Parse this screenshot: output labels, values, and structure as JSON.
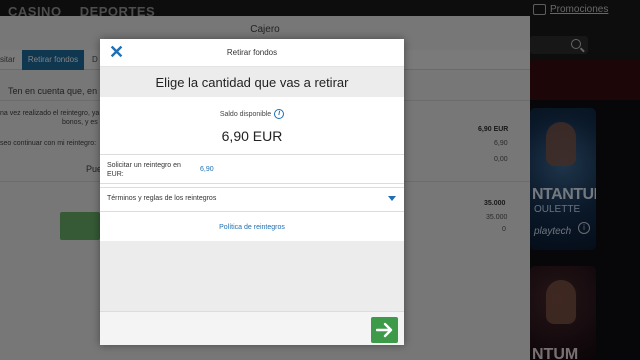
{
  "topbar": {
    "nav": [
      "CASINO",
      "DEPORTES"
    ],
    "promo_label": "Promociones"
  },
  "games": [
    {
      "title": "NTANTUM",
      "subtitle": "OULETTE",
      "brand": "playtech",
      "info": "i"
    },
    {
      "title": "NTUM"
    }
  ],
  "cashier": {
    "title": "Cajero",
    "tabs": [
      "sitar",
      "Retirar fondos",
      "D"
    ],
    "notice": "Ten en cuenta que, en",
    "lines": [
      "na vez realizado el reintegro, ya",
      "bonos, y es pos",
      "seo continuar con mi reintegro:",
      "Pue"
    ],
    "values_right": [
      "6,90 EUR",
      "6,90",
      "0,00",
      "35.000",
      "35.000",
      "0"
    ]
  },
  "modal": {
    "title": "Retirar fondos",
    "heading": "Elige la cantidad que vas a retirar",
    "balance_label": "Saldo disponible",
    "balance_info_icon": "i",
    "balance_amount": "6,90  EUR",
    "request_label": "Solicitar un reintegro en EUR:",
    "request_value": "6,90",
    "terms_label": "Términos y reglas de los reintegros",
    "policy_link": "Política de reintegros"
  }
}
